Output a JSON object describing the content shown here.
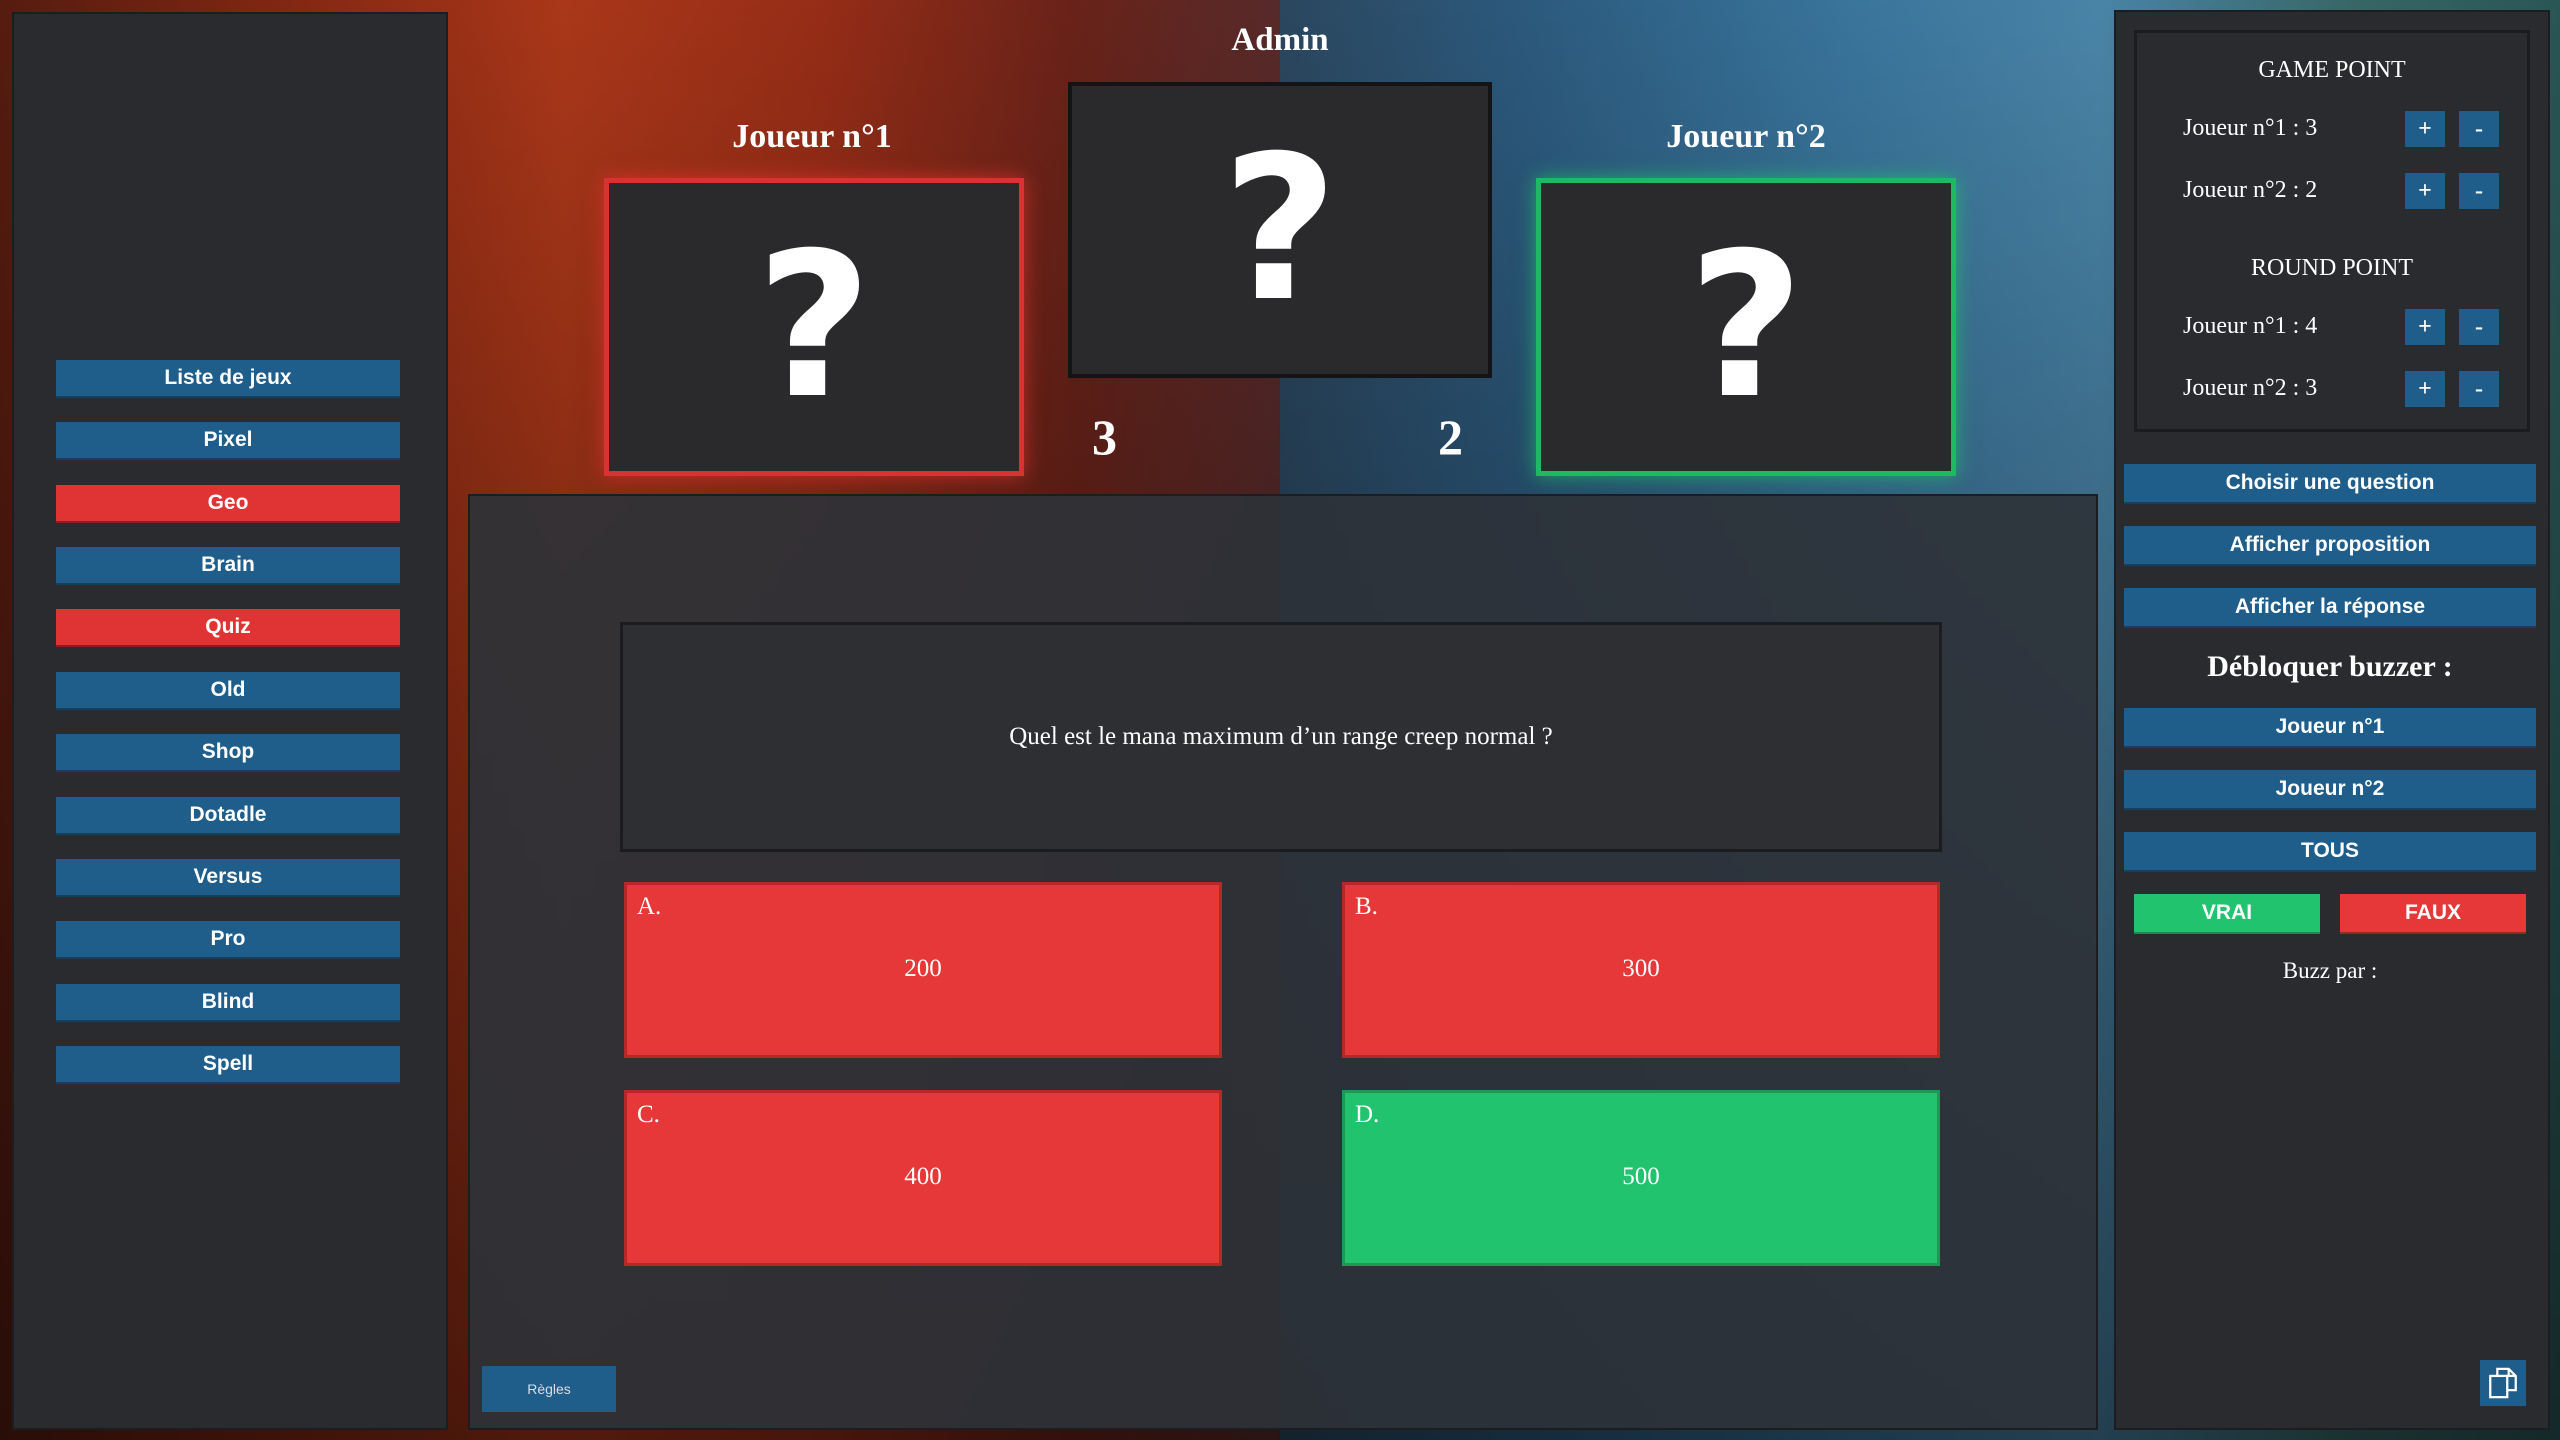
{
  "title": "Admin",
  "games": [
    {
      "label": "Liste de jeux",
      "active": false
    },
    {
      "label": "Pixel",
      "active": false
    },
    {
      "label": "Geo",
      "active": true
    },
    {
      "label": "Brain",
      "active": false
    },
    {
      "label": "Quiz",
      "active": true
    },
    {
      "label": "Old",
      "active": false
    },
    {
      "label": "Shop",
      "active": false
    },
    {
      "label": "Dotadle",
      "active": false
    },
    {
      "label": "Versus",
      "active": false
    },
    {
      "label": "Pro",
      "active": false
    },
    {
      "label": "Blind",
      "active": false
    },
    {
      "label": "Spell",
      "active": false
    }
  ],
  "players": {
    "p1": {
      "name": "Joueur n°1",
      "score": "3",
      "border": "#d83333"
    },
    "p2": {
      "name": "Joueur n°2",
      "score": "2",
      "border": "#1fb865"
    },
    "card_symbol": "?"
  },
  "question": "Quel est le mana maximum d’un range creep normal ?",
  "answers": [
    {
      "letter": "A.",
      "value": "200",
      "state": "red"
    },
    {
      "letter": "B.",
      "value": "300",
      "state": "red"
    },
    {
      "letter": "C.",
      "value": "400",
      "state": "red"
    },
    {
      "letter": "D.",
      "value": "500",
      "state": "green"
    }
  ],
  "rules_label": "Règles",
  "points": {
    "game_title": "GAME POINT",
    "game_p1": "Joueur n°1 : 3",
    "game_p2": "Joueur n°2 : 2",
    "round_title": "ROUND POINT",
    "round_p1": "Joueur n°1 : 4",
    "round_p2": "Joueur n°2 : 3",
    "plus": "+",
    "minus": "-"
  },
  "controls": {
    "choose": "Choisir une question",
    "show_prop": "Afficher proposition",
    "show_answer": "Afficher la réponse",
    "unlock_title": "Débloquer buzzer :",
    "unlock_p1": "Joueur n°1",
    "unlock_p2": "Joueur n°2",
    "unlock_all": "TOUS",
    "true": "VRAI",
    "false": "FAUX",
    "buzz_by": "Buzz par :"
  },
  "colors": {
    "accent": "#1f5d8a",
    "danger": "#e63838",
    "success": "#22c36e"
  }
}
